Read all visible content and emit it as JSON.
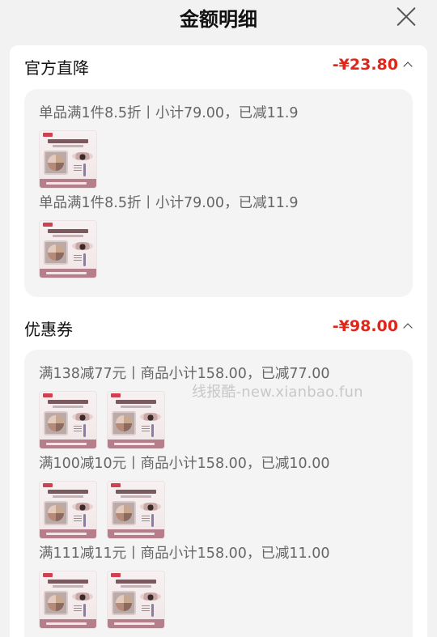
{
  "header": {
    "title": "金额明细"
  },
  "sections": [
    {
      "title": "官方直降",
      "amount": "-¥23.80",
      "groups": [
        {
          "rule": "单品满1件8.5折丨小计79.00，已减11.9",
          "products": 1
        },
        {
          "rule": "单品满1件8.5折丨小计79.00，已减11.9",
          "products": 1
        }
      ]
    },
    {
      "title": "优惠券",
      "amount": "-¥98.00",
      "groups": [
        {
          "rule": "满138减77元丨商品小计158.00，已减77.00",
          "products": 2
        },
        {
          "rule": "满100减10元丨商品小计158.00，已减10.00",
          "products": 2
        },
        {
          "rule": "满111减11元丨商品小计158.00，已减11.00",
          "products": 2
        }
      ]
    }
  ],
  "watermark": "线报酷-new.xianbao.fun",
  "icons": {
    "close": "close-icon",
    "collapse": "chevron-up-icon",
    "product": "product-thumbnail"
  },
  "colors": {
    "accent": "#e0261a",
    "background": "#f2f2f2",
    "card": "#f4f4f4"
  }
}
